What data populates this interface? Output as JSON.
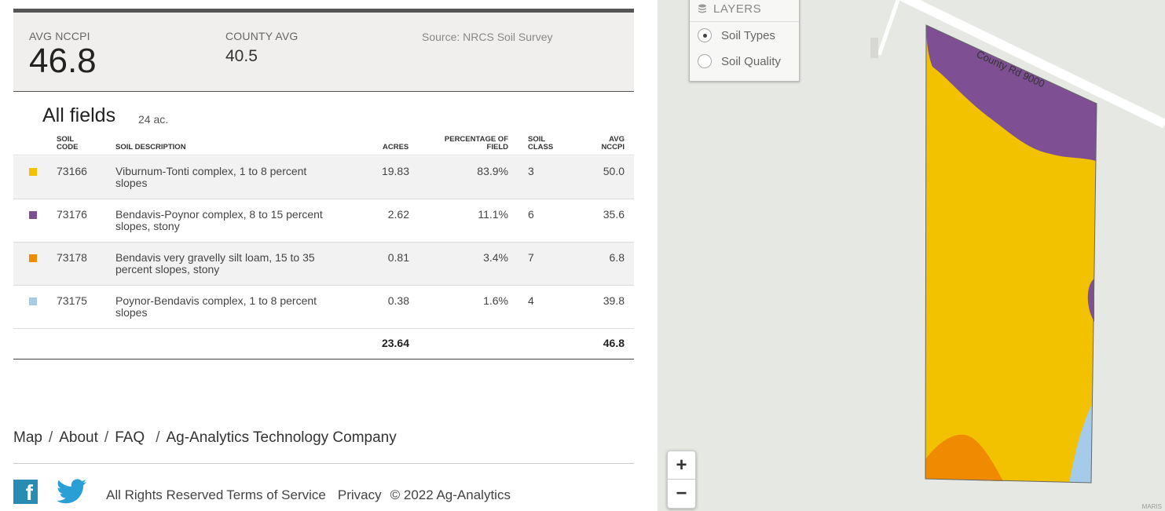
{
  "summary": {
    "avg_label": "AVG NCCPI",
    "avg_value": "46.8",
    "county_label": "COUNTY AVG",
    "county_value": "40.5",
    "source": "Source: NRCS Soil Survey"
  },
  "fields": {
    "title": "All fields",
    "acres": "24 ac."
  },
  "table": {
    "headers": {
      "code": [
        "SOIL",
        "CODE"
      ],
      "desc": "SOIL DESCRIPTION",
      "acres": "ACRES",
      "pct": [
        "PERCENTAGE OF",
        "FIELD"
      ],
      "class": [
        "SOIL",
        "CLASS"
      ],
      "nccpi": [
        "AVG",
        "NCCPI"
      ]
    },
    "rows": [
      {
        "color": "#f2c200",
        "code": "73166",
        "desc": [
          "Viburnum-Tonti complex, 1 to 8 percent",
          "slopes"
        ],
        "acres": "19.83",
        "pct": "83.9%",
        "class": "3",
        "nccpi": "50.0"
      },
      {
        "color": "#7f4f94",
        "code": "73176",
        "desc": [
          "Bendavis-Poynor complex, 8 to 15 percent",
          "slopes, stony"
        ],
        "acres": "2.62",
        "pct": "11.1%",
        "class": "6",
        "nccpi": "35.6"
      },
      {
        "color": "#f08a00",
        "code": "73178",
        "desc": [
          "Bendavis very gravelly silt loam, 15 to 35",
          "percent slopes, stony"
        ],
        "acres": "0.81",
        "pct": "3.4%",
        "class": "7",
        "nccpi": "6.8"
      },
      {
        "color": "#a6cbe8",
        "code": "73175",
        "desc": [
          "Poynor-Bendavis complex, 1 to 8 percent",
          "slopes"
        ],
        "acres": "0.38",
        "pct": "1.6%",
        "class": "4",
        "nccpi": "39.8"
      }
    ],
    "totals": {
      "acres": "23.64",
      "nccpi": "46.8"
    }
  },
  "footer": {
    "links": [
      "Map",
      "About",
      "FAQ",
      "Ag-Analytics Technology Company"
    ],
    "legal": [
      "All Rights Reserved",
      "Terms of Service",
      "Privacy",
      "© 2022 Ag-Analytics"
    ]
  },
  "map": {
    "layers_title": "LAYERS",
    "options": [
      "Soil Types",
      "Soil Quality"
    ],
    "selected": "Soil Types",
    "road_label": "County Rd 9000",
    "zoom_in": "+",
    "zoom_out": "−",
    "attribution": "MARIS"
  },
  "icons": {
    "layers": "layers-stack-icon",
    "facebook": "facebook-icon",
    "twitter": "twitter-icon"
  }
}
